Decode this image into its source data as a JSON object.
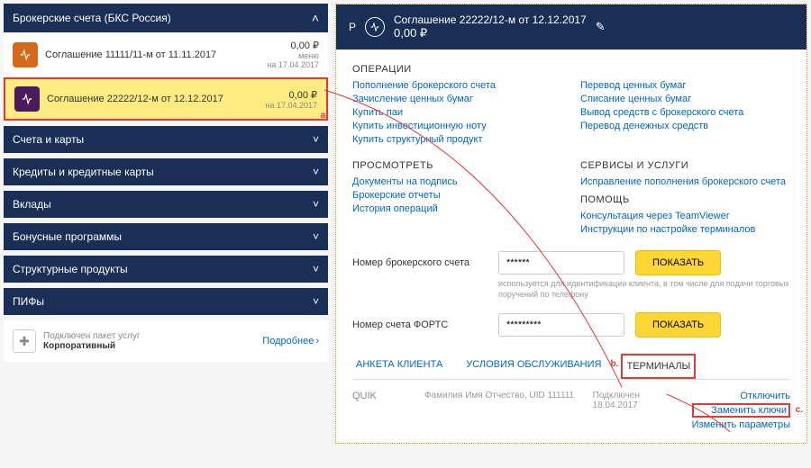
{
  "sidebar": {
    "header": "Брокерские счета (БКС Россия)",
    "agreements": [
      {
        "title": "Соглашение 11111/11-м от 11.11.2017",
        "amount": "0,00 ₽",
        "menu": "меню",
        "date": "на 17.04.2017"
      },
      {
        "title": "Соглашение 22222/12-м от 12.12.2017",
        "amount": "0,00 ₽",
        "menu": "",
        "date": "на 17.04.2017"
      }
    ],
    "sections": [
      "Счета и карты",
      "Кредиты и кредитные карты",
      "Вклады",
      "Бонусные программы",
      "Структурные продукты",
      "ПИФы"
    ],
    "package": {
      "line1": "Подключен пакет услуг",
      "line2": "Корпоративный",
      "more": "Подробнее"
    }
  },
  "detail": {
    "header_title": "Соглашение 22222/12-м от 12.12.2017",
    "header_amount": "0,00 ₽",
    "prefix": "Р",
    "operations": {
      "title": "ОПЕРАЦИИ",
      "left": [
        "Пополнение брокерского счета",
        "Зачисление ценных бумаг",
        "Купить паи",
        "Купить инвестиционную ноту",
        "Купить структурный продукт"
      ],
      "right": [
        "Перевод ценных бумаг",
        "Списание ценных бумаг",
        "Вывод средств с брокерского счета",
        "Перевод денежных средств"
      ]
    },
    "view": {
      "title": "ПРОСМОТРЕТЬ",
      "left": [
        "Документы на подпись",
        "Брокерские отчеты",
        "История операций"
      ]
    },
    "services": {
      "title": "СЕРВИСЫ И УСЛУГИ",
      "items": [
        "Исправление пополнения брокерского счета"
      ]
    },
    "help": {
      "title": "ПОМОЩЬ",
      "items": [
        "Консультация через TeamViewer",
        "Инструкции по настройке терминалов"
      ]
    },
    "fields": {
      "broker_label": "Номер брокерского счета",
      "broker_value": "******",
      "broker_hint": "используется для идентификации клиента, в том числе для подачи торговых поручений по телефону",
      "forts_label": "Номер счета ФОРТС",
      "forts_value": "*********",
      "show_btn": "ПОКАЗАТЬ"
    },
    "tabs": {
      "anketa": "АНКЕТА КЛИЕНТА",
      "terms": "УСЛОВИЯ ОБСЛУЖИВАНИЯ",
      "terminals": "ТЕРМИНАЛЫ"
    },
    "quik": {
      "name": "QUIK",
      "user": "Фамилия Имя Отчество, UID 111111",
      "conn_label": "Подключен",
      "conn_date": "18.04.2017",
      "actions": {
        "disconnect": "Отключить",
        "replace": "Заменить ключи",
        "params": "Изменить параметры"
      }
    }
  }
}
